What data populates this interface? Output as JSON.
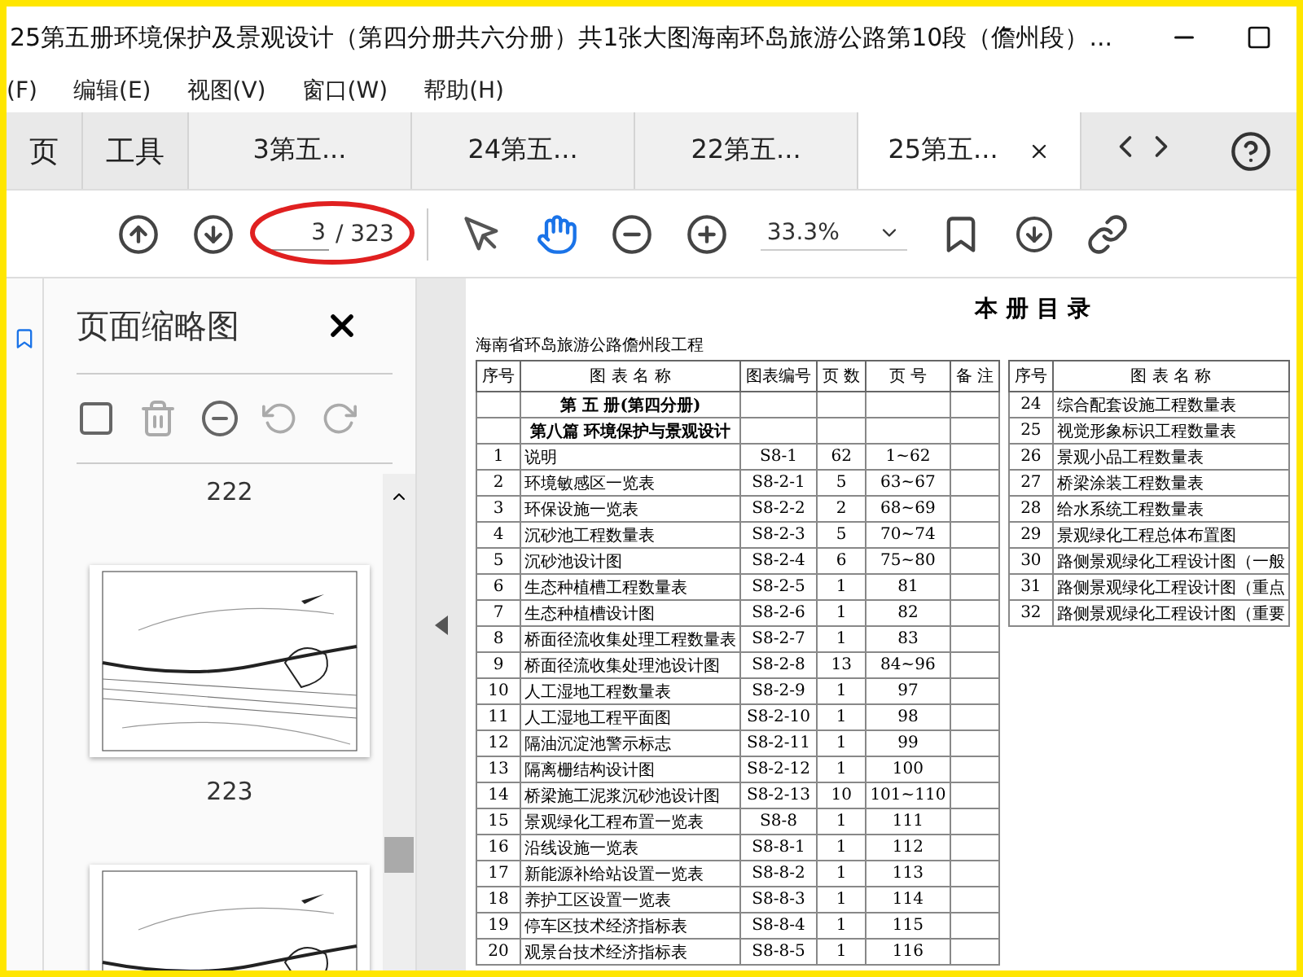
{
  "window": {
    "title": "25第五册环境保护及景观设计（第四分册共六分册）共1张大图海南环岛旅游公路第10段（儋州段）..."
  },
  "menu": [
    "(F)",
    "编辑(E)",
    "视图(V)",
    "窗口(W)",
    "帮助(H)"
  ],
  "tabs": [
    {
      "label": "页",
      "kind": "home",
      "selected": false
    },
    {
      "label": "工具",
      "kind": "home",
      "selected": false
    },
    {
      "label": "3第五...",
      "kind": "doc",
      "selected": false
    },
    {
      "label": "24第五...",
      "kind": "doc",
      "selected": false
    },
    {
      "label": "22第五...",
      "kind": "doc",
      "selected": false
    },
    {
      "label": "25第五...",
      "kind": "doc",
      "selected": true
    }
  ],
  "toolbar": {
    "page_field": {
      "value": "3"
    },
    "page_total": "/ 323",
    "tools": [
      {
        "kind": "select",
        "selected": false
      },
      {
        "kind": "hand",
        "selected": true
      }
    ],
    "zoom": "33.3%"
  },
  "thumbnails": {
    "title": "页面缩略图",
    "items": [
      {
        "kind": "label",
        "text": "222"
      },
      {
        "kind": "preview"
      },
      {
        "kind": "label",
        "text": "223"
      },
      {
        "kind": "preview"
      }
    ]
  },
  "document": {
    "title": "本 册 目 录",
    "subtitle": "海南省环岛旅游公路儋州段工程",
    "main_table": {
      "columns": [
        "序号",
        "图 表 名 称",
        "图表编号",
        "页 数",
        "页 号",
        "备 注"
      ],
      "rows": [
        {
          "kind": "section",
          "text": "第 五 册(第四分册)"
        },
        {
          "kind": "section",
          "text": "第八篇  环境保护与景观设计"
        },
        {
          "kind": "entry",
          "no": "1",
          "name": "说明",
          "code": "S8-1",
          "count": "62",
          "pages": "1~62"
        },
        {
          "kind": "entry",
          "no": "2",
          "name": "环境敏感区一览表",
          "code": "S8-2-1",
          "count": "5",
          "pages": "63~67"
        },
        {
          "kind": "entry",
          "no": "3",
          "name": "环保设施一览表",
          "code": "S8-2-2",
          "count": "2",
          "pages": "68~69"
        },
        {
          "kind": "entry",
          "no": "4",
          "name": "沉砂池工程数量表",
          "code": "S8-2-3",
          "count": "5",
          "pages": "70~74"
        },
        {
          "kind": "entry",
          "no": "5",
          "name": "沉砂池设计图",
          "code": "S8-2-4",
          "count": "6",
          "pages": "75~80"
        },
        {
          "kind": "entry",
          "no": "6",
          "name": "生态种植槽工程数量表",
          "code": "S8-2-5",
          "count": "1",
          "pages": "81"
        },
        {
          "kind": "entry",
          "no": "7",
          "name": "生态种植槽设计图",
          "code": "S8-2-6",
          "count": "1",
          "pages": "82"
        },
        {
          "kind": "entry",
          "no": "8",
          "name": "桥面径流收集处理工程数量表",
          "code": "S8-2-7",
          "count": "1",
          "pages": "83"
        },
        {
          "kind": "entry",
          "no": "9",
          "name": "桥面径流收集处理池设计图",
          "code": "S8-2-8",
          "count": "13",
          "pages": "84~96"
        },
        {
          "kind": "entry",
          "no": "10",
          "name": "人工湿地工程数量表",
          "code": "S8-2-9",
          "count": "1",
          "pages": "97"
        },
        {
          "kind": "entry",
          "no": "11",
          "name": "人工湿地工程平面图",
          "code": "S8-2-10",
          "count": "1",
          "pages": "98"
        },
        {
          "kind": "entry",
          "no": "12",
          "name": "隔油沉淀池警示标志",
          "code": "S8-2-11",
          "count": "1",
          "pages": "99"
        },
        {
          "kind": "entry",
          "no": "13",
          "name": "隔离栅结构设计图",
          "code": "S8-2-12",
          "count": "1",
          "pages": "100"
        },
        {
          "kind": "entry",
          "no": "14",
          "name": "桥梁施工泥浆沉砂池设计图",
          "code": "S8-2-13",
          "count": "10",
          "pages": "101~110"
        },
        {
          "kind": "entry",
          "no": "15",
          "name": "景观绿化工程布置一览表",
          "code": "S8-8",
          "count": "1",
          "pages": "111"
        },
        {
          "kind": "entry",
          "no": "16",
          "name": "沿线设施一览表",
          "code": "S8-8-1",
          "count": "1",
          "pages": "112"
        },
        {
          "kind": "entry",
          "no": "17",
          "name": "新能源补给站设置一览表",
          "code": "S8-8-2",
          "count": "1",
          "pages": "113"
        },
        {
          "kind": "entry",
          "no": "18",
          "name": "养护工区设置一览表",
          "code": "S8-8-3",
          "count": "1",
          "pages": "114"
        },
        {
          "kind": "entry",
          "no": "19",
          "name": "停车区技术经济指标表",
          "code": "S8-8-4",
          "count": "1",
          "pages": "115"
        },
        {
          "kind": "entry",
          "no": "20",
          "name": "观景台技术经济指标表",
          "code": "S8-8-5",
          "count": "1",
          "pages": "116"
        }
      ]
    },
    "side_table": {
      "columns": [
        "序号",
        "图 表 名 称"
      ],
      "rows": [
        {
          "no": "24",
          "name": "综合配套设施工程数量表"
        },
        {
          "no": "25",
          "name": "视觉形象标识工程数量表"
        },
        {
          "no": "26",
          "name": "景观小品工程数量表"
        },
        {
          "no": "27",
          "name": "桥梁涂装工程数量表"
        },
        {
          "no": "28",
          "name": "给水系统工程数量表"
        },
        {
          "no": "29",
          "name": "景观绿化工程总体布置图"
        },
        {
          "no": "30",
          "name": "路侧景观绿化工程设计图（一般"
        },
        {
          "no": "31",
          "name": "路侧景观绿化工程设计图（重点"
        },
        {
          "no": "32",
          "name": "路侧景观绿化工程设计图（重要"
        }
      ]
    }
  }
}
